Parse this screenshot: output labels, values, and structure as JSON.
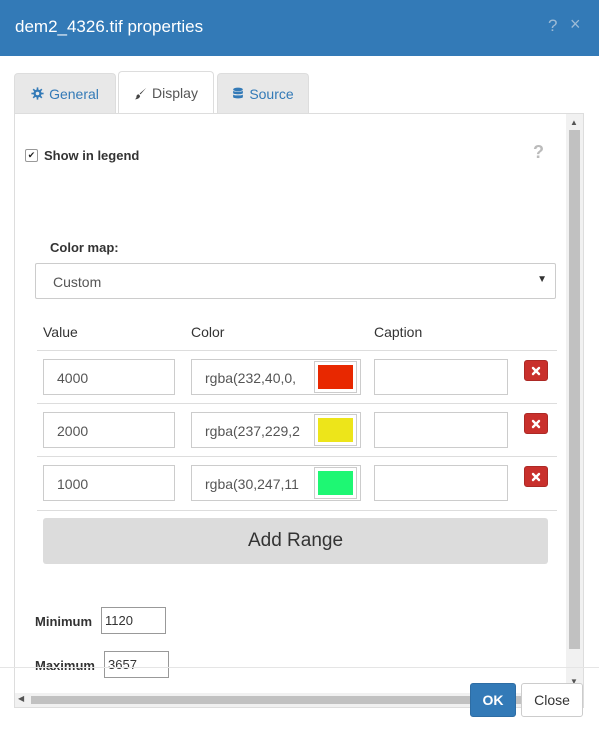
{
  "dialog": {
    "title": "dem2_4326.tif properties",
    "help_glyph": "?",
    "close_glyph": "×"
  },
  "tabs": [
    {
      "label": "General",
      "icon": "gear-icon",
      "active": false
    },
    {
      "label": "Display",
      "icon": "paintbrush-icon",
      "active": true
    },
    {
      "label": "Source",
      "icon": "database-icon",
      "active": false
    }
  ],
  "display": {
    "show_in_legend_label": "Show in legend",
    "show_in_legend_checked": true,
    "help_glyph": "?",
    "color_map_label": "Color map:",
    "color_map_value": "Custom",
    "columns": {
      "value": "Value",
      "color": "Color",
      "caption": "Caption"
    },
    "ranges": [
      {
        "value": "4000",
        "color_text": "rgba(232,40,0,",
        "swatch": "#e82800",
        "caption": ""
      },
      {
        "value": "2000",
        "color_text": "rgba(237,229,2",
        "swatch": "#ede51a",
        "caption": ""
      },
      {
        "value": "1000",
        "color_text": "rgba(30,247,11",
        "swatch": "#1ef773",
        "caption": ""
      }
    ],
    "add_range_label": "Add Range",
    "minimum_label": "Minimum",
    "minimum_value": "1120",
    "maximum_label": "Maximum",
    "maximum_value": "3657"
  },
  "footer": {
    "ok_label": "OK",
    "close_label": "Close"
  },
  "colors": {
    "header": "#337ab7",
    "delete_button": "#c9302c",
    "tab_link": "#337ab7"
  }
}
